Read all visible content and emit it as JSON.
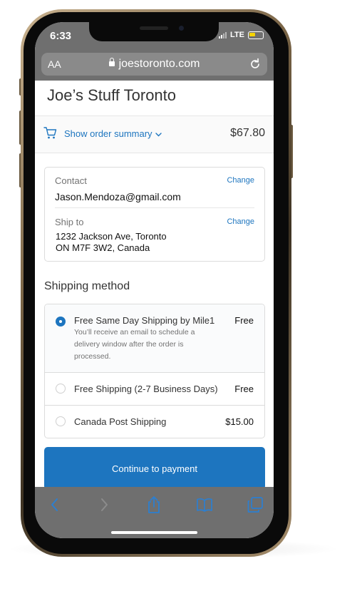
{
  "status": {
    "time": "6:33",
    "network": "LTE"
  },
  "browser": {
    "aa_label": "AA",
    "url": "joestoronto.com"
  },
  "store": {
    "title": "Joe’s Stuff Toronto"
  },
  "order_summary": {
    "label": "Show order summary",
    "total": "$67.80"
  },
  "contact": {
    "label": "Contact",
    "value": "Jason.Mendoza@gmail.com",
    "change_label": "Change"
  },
  "ship_to": {
    "label": "Ship to",
    "address_line1": "1232 Jackson Ave, Toronto",
    "address_line2": "ON M7F 3W2, Canada",
    "change_label": "Change"
  },
  "shipping": {
    "title": "Shipping method",
    "options": [
      {
        "name": "Free Same Day Shipping by Mile1",
        "price": "Free",
        "description": "You’ll receive an email to schedule a delivery window after the order is processed.",
        "selected": true
      },
      {
        "name": "Free Shipping (2-7 Business Days)",
        "price": "Free",
        "selected": false
      },
      {
        "name": "Canada Post Shipping",
        "price": "$15.00",
        "selected": false
      }
    ]
  },
  "continue_button": {
    "label": "Continue to payment"
  },
  "colors": {
    "accent": "#1d75bf",
    "safari_chrome": "#6f6f6f",
    "battery": "#f5d300",
    "frame_gold": "#a58d6b"
  }
}
